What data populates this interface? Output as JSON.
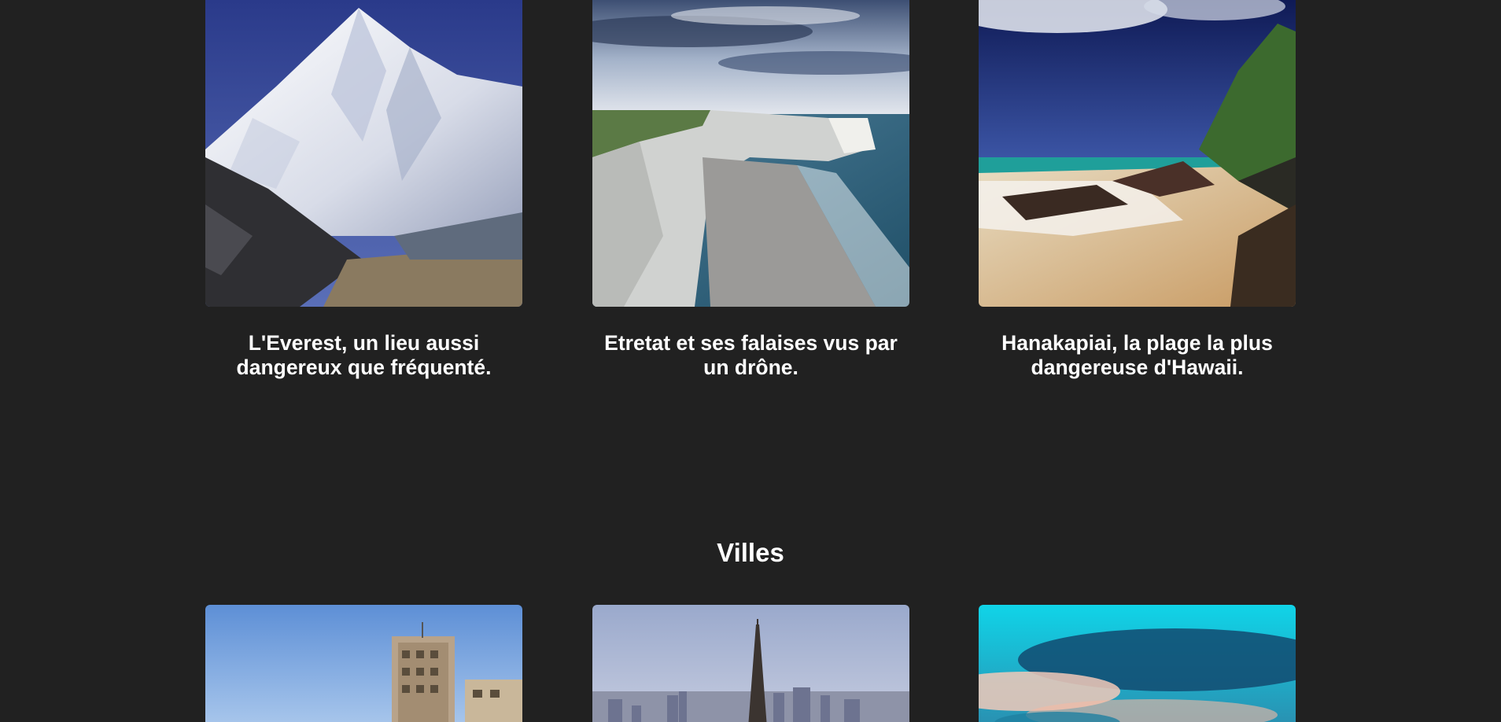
{
  "nature": {
    "cards": [
      {
        "caption": "L'Everest, un lieu aussi dangereux que fréquenté.",
        "image": "everest-photo"
      },
      {
        "caption": "Etretat et ses falaises vus par un drône.",
        "image": "etretat-cliffs-photo"
      },
      {
        "caption": "Hanakapiai, la plage la plus dangereuse d'Hawaii.",
        "image": "hanakapiai-beach-photo"
      }
    ]
  },
  "villes": {
    "title": "Villes",
    "cards": [
      {
        "image": "city-building-photo"
      },
      {
        "image": "paris-eiffel-tower-photo"
      },
      {
        "image": "turquoise-sky-photo"
      }
    ]
  },
  "colors": {
    "background": "#212121",
    "text": "#ffffff"
  }
}
